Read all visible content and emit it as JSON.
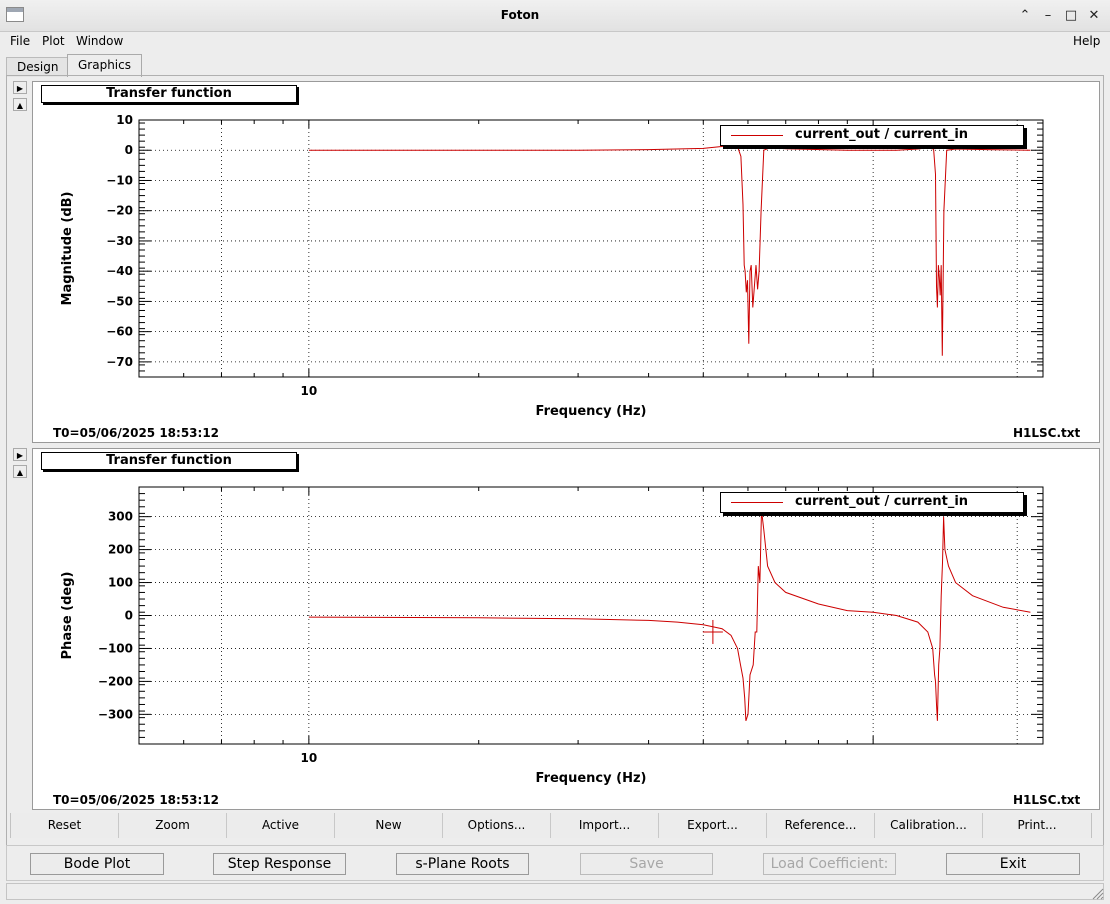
{
  "window": {
    "title": "Foton"
  },
  "menu": {
    "file": "File",
    "plot": "Plot",
    "window": "Window",
    "help": "Help"
  },
  "tabs": {
    "design": "Design",
    "graphics": "Graphics"
  },
  "panels": [
    {
      "title": "Transfer function",
      "ylabel": "Magnitude (dB)",
      "xlabel": "Frequency (Hz)",
      "legend": "current_out / current_in",
      "t0": "T0=05/06/2025 18:53:12",
      "file": "H1LSC.txt",
      "ytick_labels": [
        "10",
        "0",
        "−10",
        "−20",
        "−30",
        "−40",
        "−50",
        "−60",
        "−70"
      ],
      "xtick_label": "10"
    },
    {
      "title": "Transfer function",
      "ylabel": "Phase (deg)",
      "xlabel": "Frequency (Hz)",
      "legend": "current_out / current_in",
      "t0": "T0=05/06/2025 18:53:12",
      "file": "H1LSC.txt",
      "ytick_labels": [
        "300",
        "200",
        "100",
        "0",
        "−100",
        "−200",
        "−300"
      ],
      "xtick_label": "10"
    }
  ],
  "toolbar": {
    "reset": "Reset",
    "zoom": "Zoom",
    "active": "Active",
    "new": "New",
    "options": "Options...",
    "import": "Import...",
    "export": "Export...",
    "reference": "Reference...",
    "calibration": "Calibration...",
    "print": "Print..."
  },
  "actions": {
    "bode": "Bode Plot",
    "step": "Step Response",
    "splane": "s-Plane Roots",
    "save": "Save",
    "load": "Load Coefficient:",
    "exit": "Exit"
  },
  "colors": {
    "trace": "#cc0000",
    "grid": "#000000",
    "background": "#ffffff"
  },
  "chart_data": [
    {
      "type": "line",
      "title": "Transfer function",
      "xlabel": "Frequency (Hz)",
      "ylabel": "Magnitude (dB)",
      "xscale": "log",
      "xlim": [
        5,
        200
      ],
      "ylim": [
        -75,
        10
      ],
      "x_ticks_labeled": [
        10
      ],
      "y_ticks": [
        10,
        0,
        -10,
        -20,
        -30,
        -40,
        -50,
        -60,
        -70
      ],
      "grid": true,
      "legend_position": "top-right",
      "series": [
        {
          "name": "current_out / current_in",
          "color": "#cc0000",
          "x": [
            10,
            20,
            30,
            40,
            50,
            55,
            57.5,
            58.3,
            58.8,
            59.1,
            59.3,
            59.6,
            59.9,
            60.2,
            60.5,
            60.8,
            61.2,
            61.6,
            62.0,
            62.4,
            62.8,
            63.3,
            64,
            66,
            70,
            90,
            110,
            120,
            125,
            128,
            129,
            129.5,
            130,
            130.5,
            131,
            131.5,
            132,
            132.6,
            133.5,
            135,
            140,
            160,
            190
          ],
          "values": [
            0,
            0,
            0,
            0.2,
            0.6,
            1.4,
            1.2,
            -2,
            -18,
            -38,
            -40,
            -47,
            -43,
            -64,
            -40,
            -38,
            -52,
            -45,
            -38,
            -46,
            -40,
            -20,
            0,
            1.0,
            0.5,
            0,
            0,
            0.4,
            0.8,
            0.4,
            -8,
            -45,
            -52,
            -38,
            -42,
            -48,
            -38,
            -68,
            -20,
            0,
            0.4,
            0.2,
            0
          ]
        }
      ]
    },
    {
      "type": "line",
      "title": "Transfer function",
      "xlabel": "Frequency (Hz)",
      "ylabel": "Phase (deg)",
      "xscale": "log",
      "xlim": [
        5,
        200
      ],
      "ylim": [
        -390,
        390
      ],
      "x_ticks_labeled": [
        10
      ],
      "y_ticks": [
        300,
        200,
        100,
        0,
        -100,
        -200,
        -300
      ],
      "grid": true,
      "legend_position": "top-right",
      "series": [
        {
          "name": "current_out / current_in",
          "color": "#cc0000",
          "x": [
            10,
            20,
            30,
            40,
            45,
            50,
            54,
            56,
            57.5,
            58.2,
            58.8,
            59.2,
            59.5,
            60,
            60.5,
            61.3,
            61.8,
            62.2,
            62.6,
            63,
            63.4,
            64,
            65,
            67,
            70,
            80,
            90,
            100,
            110,
            120,
            125,
            127.5,
            128.5,
            129,
            129.5,
            130,
            130.7,
            131.3,
            132,
            132.7,
            133.3,
            134,
            136,
            140,
            150,
            170,
            190
          ],
          "values": [
            -5,
            -7,
            -10,
            -15,
            -20,
            -28,
            -40,
            -60,
            -100,
            -150,
            -190,
            -250,
            -320,
            -300,
            -180,
            -150,
            -50,
            -50,
            150,
            100,
            320,
            260,
            150,
            100,
            70,
            35,
            15,
            10,
            0,
            -20,
            -50,
            -100,
            -180,
            -200,
            -270,
            -320,
            -150,
            -100,
            60,
            160,
            300,
            200,
            150,
            100,
            60,
            25,
            10
          ]
        }
      ]
    }
  ]
}
